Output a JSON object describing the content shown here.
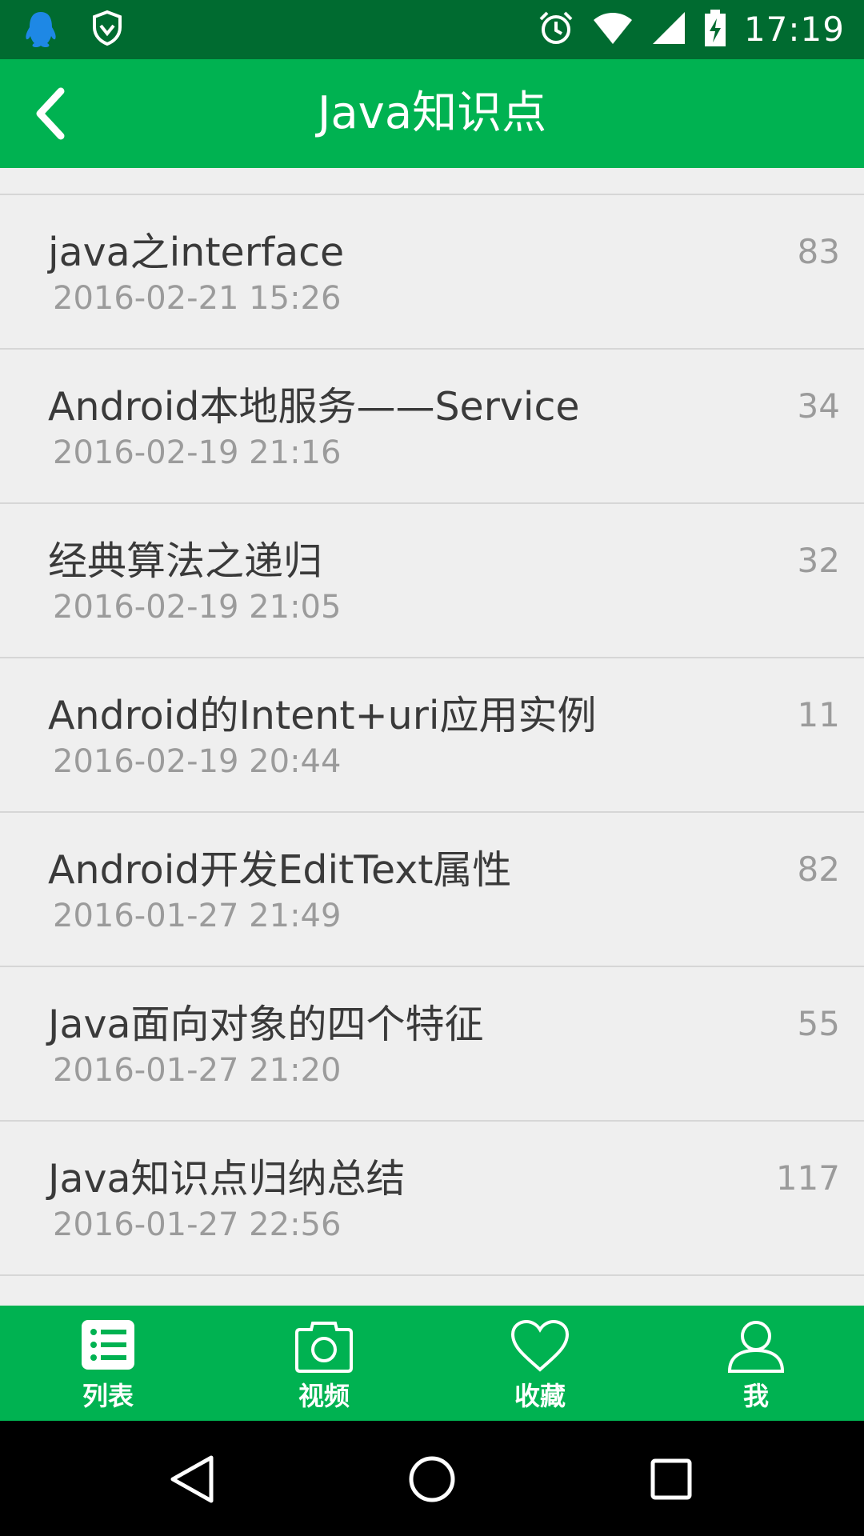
{
  "status_bar": {
    "time": "17:19",
    "left_icons": [
      "qq-icon",
      "shield-icon"
    ],
    "right_icons": [
      "alarm-icon",
      "wifi-icon",
      "signal-icon",
      "battery-charging-icon"
    ]
  },
  "app_bar": {
    "title": "Java知识点",
    "back_icon": "chevron-left-icon"
  },
  "articles": [
    {
      "title": "java之interface",
      "date": "2016-02-21 15:26",
      "count": "83"
    },
    {
      "title": "Android本地服务——Service",
      "date": "2016-02-19 21:16",
      "count": "34"
    },
    {
      "title": "经典算法之递归",
      "date": "2016-02-19 21:05",
      "count": "32"
    },
    {
      "title": "Android的Intent+uri应用实例",
      "date": "2016-02-19 20:44",
      "count": "11"
    },
    {
      "title": "Android开发EditText属性",
      "date": "2016-01-27 21:49",
      "count": "82"
    },
    {
      "title": "Java面向对象的四个特征",
      "date": "2016-01-27 21:20",
      "count": "55"
    },
    {
      "title": "Java知识点归纳总结",
      "date": "2016-01-27 22:56",
      "count": "117"
    }
  ],
  "tabs": [
    {
      "label": "列表",
      "icon": "list-icon"
    },
    {
      "label": "视频",
      "icon": "camera-icon"
    },
    {
      "label": "收藏",
      "icon": "heart-icon"
    },
    {
      "label": "我",
      "icon": "user-icon"
    }
  ],
  "nav_bar": {
    "icons": [
      "back-triangle-icon",
      "home-circle-icon",
      "recents-square-icon"
    ]
  },
  "colors": {
    "status_bar": "#006b30",
    "primary": "#00b251",
    "background": "#efefef",
    "title_text": "#3a3a3a",
    "secondary_text": "#9b9b9b"
  }
}
